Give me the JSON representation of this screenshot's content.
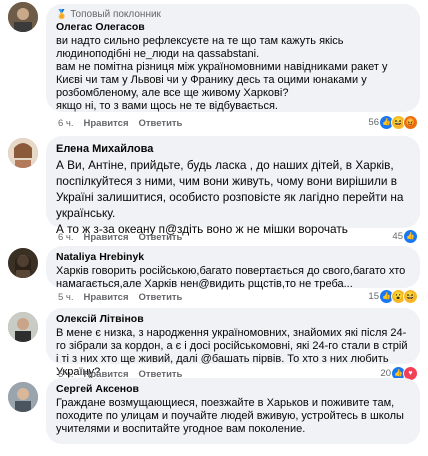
{
  "comments": [
    {
      "badge": "Топовый поклонник",
      "author": "Олегас Олегасов",
      "text": "ви надто сильно рефлексуєте на те що там кажуть якісь людиноподібні не_люди на qassabstani.\nвам не помітна різниця між україномовними навідниками ракет у Києві чи там у Львові чи у Франику десь та оцими юнаками у розбомбленому, але все ще живому Харкові?\nякщо ні, то з вами щось не те відбувається.",
      "time": "6 ч.",
      "like": "Нравится",
      "reply": "Ответить",
      "reactions_count": "56",
      "reactions": [
        "like",
        "haha",
        "angry"
      ]
    },
    {
      "author": "Елена Михайлова",
      "text": "А Ви, Антіне, прийдьте, будь ласка , до наших дітей, в Харків, поспілкуйтеся з ними, чим вони живуть, чому вони вирішили в Україні залишитися, особисто розповісте як лагідно перейти на українську.\nА то ж з-за океану п@здіть воно ж не мішки ворочать",
      "time": "6 ч.",
      "like": "Нравится",
      "reply": "Ответить",
      "reactions_count": "45",
      "reactions": [
        "like"
      ]
    },
    {
      "author": "Nataliya Hrebinyk",
      "text": "Харків говорить російською,багато повертається до свого,багато хто намагається,але Харків нен@видить рщстів,то не треба...",
      "time": "5 ч.",
      "like": "Нравится",
      "reply": "Ответить",
      "reactions_count": "15",
      "reactions": [
        "like",
        "wow",
        "haha"
      ]
    },
    {
      "author": "Олексій Літвінов",
      "text": "В мене є низка, з народження україномовних, знайомих які після 24-го зібрали за кордон, а є і досі російськомовні, які 24-го стали в стрій і ті з них хто ще живий, далі @башать пірвів. То хто з них любить Україну?",
      "time": "5 ч.",
      "like": "Нравится",
      "reply": "Ответить",
      "reactions_count": "20",
      "reactions": [
        "like",
        "heart"
      ]
    },
    {
      "author": "Сергей Аксенов",
      "text": "Граждане возмущающиеся, поезжайте в Харьков и поживите там, походите по улицам и поучайте людей вживую, устройтесь в школы учителями и воспитайте угодное вам поколение.",
      "time": "",
      "like": "",
      "reply": "",
      "reactions_count": "",
      "reactions": []
    }
  ],
  "colors": {
    "bubble": "#f0f2f5",
    "meta": "#65676b",
    "like": "#1877f2"
  }
}
